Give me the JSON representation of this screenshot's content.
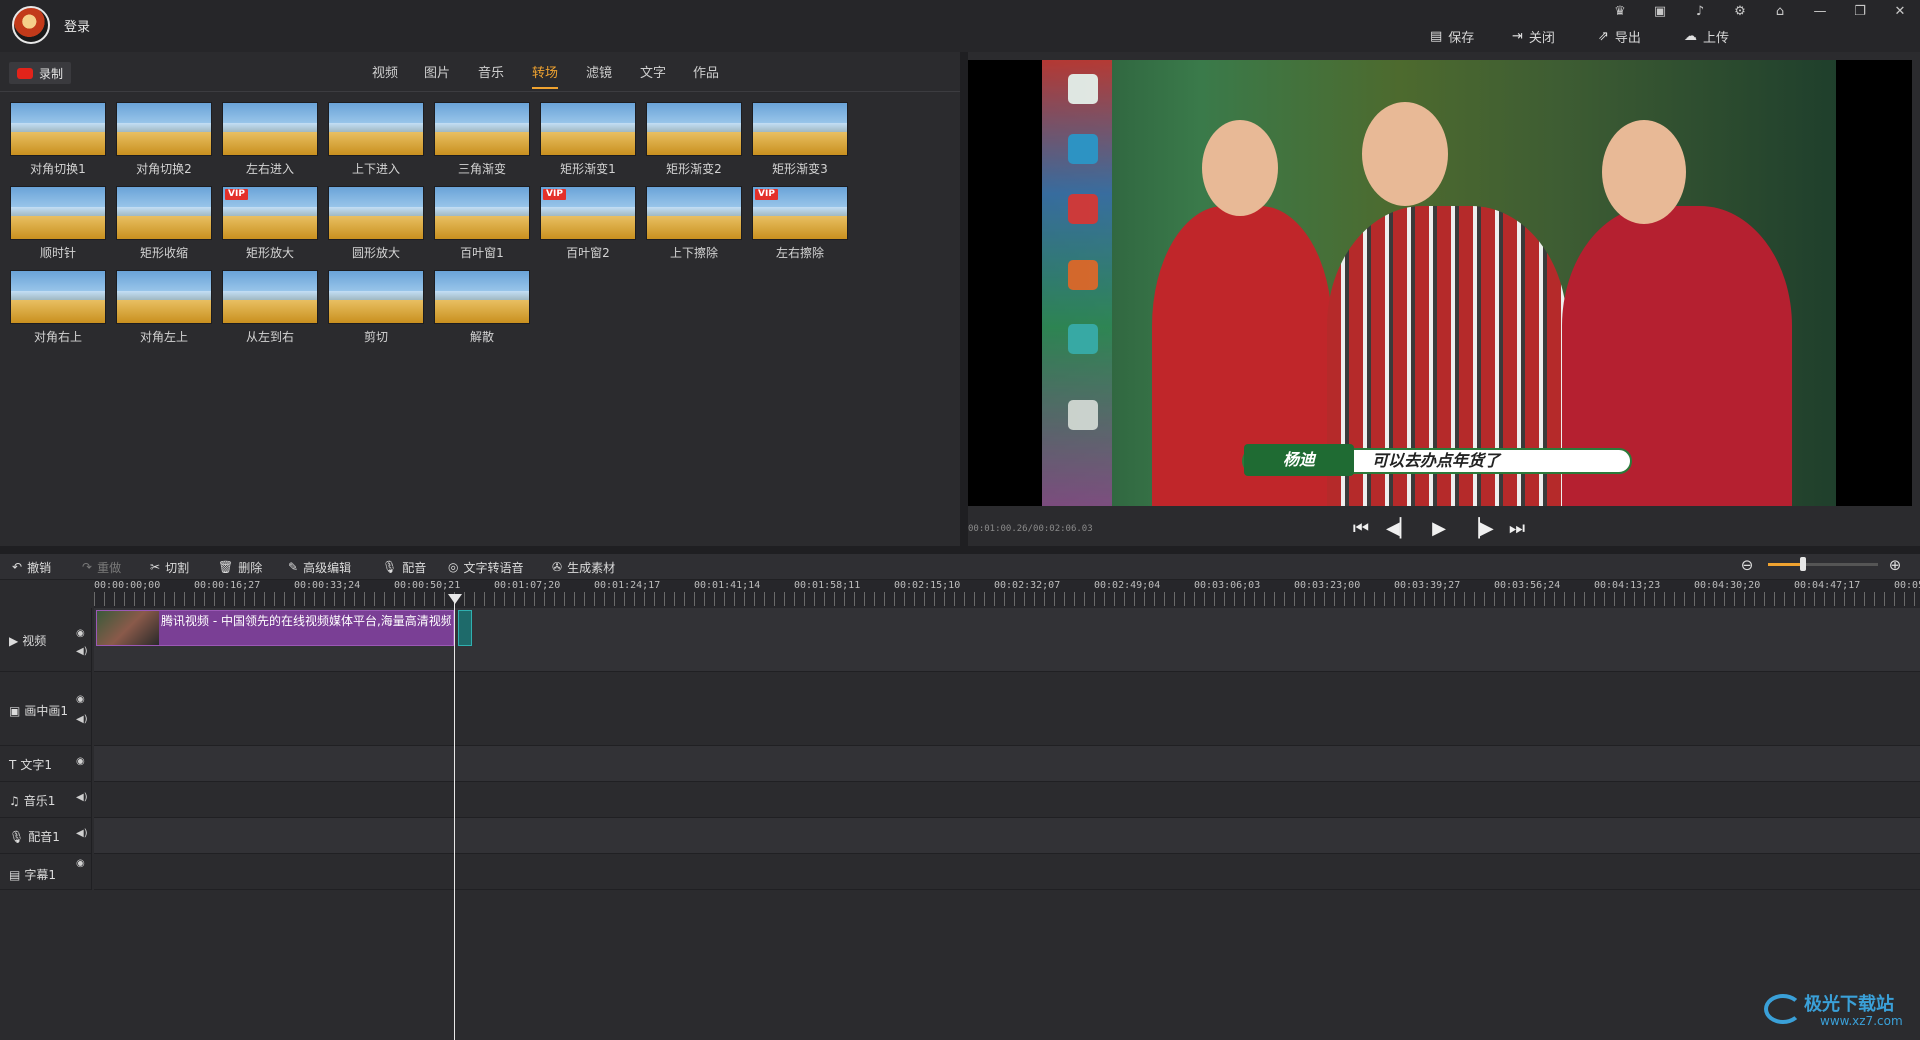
{
  "titlebar": {
    "login": "登录",
    "save": "保存",
    "close": "关闭",
    "export": "导出",
    "upload": "上传",
    "icons": [
      "vip-crown-icon",
      "player-icon",
      "bell-icon",
      "gear-icon",
      "home-icon",
      "minimize-icon",
      "restore-icon",
      "close-icon"
    ]
  },
  "library": {
    "record": "录制",
    "tabs": [
      "视频",
      "图片",
      "音乐",
      "转场",
      "滤镜",
      "文字",
      "作品"
    ],
    "active_tab": "转场",
    "transitions": [
      {
        "label": "对角切换1",
        "vip": false
      },
      {
        "label": "对角切换2",
        "vip": false
      },
      {
        "label": "左右进入",
        "vip": false
      },
      {
        "label": "上下进入",
        "vip": false
      },
      {
        "label": "三角渐变",
        "vip": false
      },
      {
        "label": "矩形渐变1",
        "vip": false
      },
      {
        "label": "矩形渐变2",
        "vip": false
      },
      {
        "label": "矩形渐变3",
        "vip": false
      },
      {
        "label": "顺时针",
        "vip": false
      },
      {
        "label": "矩形收缩",
        "vip": false
      },
      {
        "label": "矩形放大",
        "vip": true
      },
      {
        "label": "圆形放大",
        "vip": false
      },
      {
        "label": "百叶窗1",
        "vip": false
      },
      {
        "label": "百叶窗2",
        "vip": true
      },
      {
        "label": "上下擦除",
        "vip": false
      },
      {
        "label": "左右擦除",
        "vip": true
      },
      {
        "label": "对角右上",
        "vip": false
      },
      {
        "label": "对角左上",
        "vip": false
      },
      {
        "label": "从左到右",
        "vip": false
      },
      {
        "label": "剪切",
        "vip": false
      },
      {
        "label": "解散",
        "vip": false
      }
    ],
    "vip_badge": "VIP"
  },
  "preview": {
    "timecode": "00:01:00.26/00:02:06.03",
    "subtitle_name": "杨迪",
    "subtitle_text": "可以去办点年货了"
  },
  "toolbar": {
    "undo": "撤销",
    "redo": "重做",
    "cut": "切割",
    "delete": "删除",
    "advanced_edit": "高级编辑",
    "dub": "配音",
    "tts": "文字转语音",
    "generate": "生成素材"
  },
  "ruler": {
    "labels": [
      "00:00:00;00",
      "00:00:16;27",
      "00:00:33;24",
      "00:00:50;21",
      "00:01:07;20",
      "00:01:24;17",
      "00:01:41;14",
      "00:01:58;11",
      "00:02:15;10",
      "00:02:32;07",
      "00:02:49;04",
      "00:03:06;03",
      "00:03:23;00",
      "00:03:39;27",
      "00:03:56;24",
      "00:04:13;23",
      "00:04:30;20",
      "00:04:47;17",
      "00:05"
    ]
  },
  "tracks": {
    "video": "视频",
    "pip": "画中画1",
    "text": "文字1",
    "music": "音乐1",
    "dub": "配音1",
    "caption": "字幕1",
    "clip_title": "腾讯视频 - 中国领先的在线视频媒体平台,海量高清视频"
  },
  "watermark": {
    "text": "极光下载站",
    "url": "www.xz7.com"
  }
}
